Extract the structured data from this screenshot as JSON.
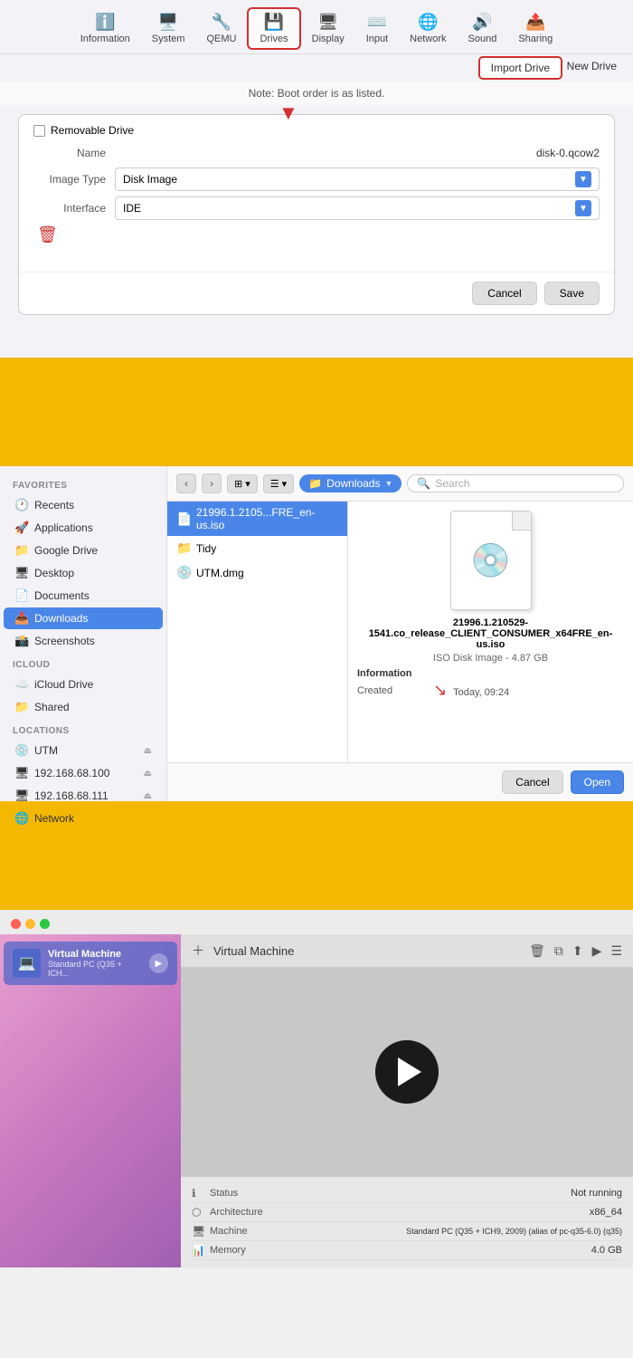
{
  "section1": {
    "toolbar": {
      "items": [
        {
          "id": "information",
          "label": "Information",
          "icon": "ℹ️"
        },
        {
          "id": "system",
          "label": "System",
          "icon": "🖥️"
        },
        {
          "id": "qemu",
          "label": "QEMU",
          "icon": "🔧"
        },
        {
          "id": "drives",
          "label": "Drives",
          "icon": "💾"
        },
        {
          "id": "display",
          "label": "Display",
          "icon": "🖥"
        },
        {
          "id": "input",
          "label": "Input",
          "icon": "⌨️"
        },
        {
          "id": "network",
          "label": "Network",
          "icon": "🌐"
        },
        {
          "id": "sound",
          "label": "Sound",
          "icon": "🔊"
        },
        {
          "id": "sharing",
          "label": "Sharing",
          "icon": "📤"
        }
      ]
    },
    "note": "Note: Boot order is as listed.",
    "import_btn": "Import Drive",
    "new_btn": "New Drive",
    "removable_label": "Removable Drive",
    "name_label": "Name",
    "name_value": "disk-0.qcow2",
    "image_type_label": "Image Type",
    "image_type_value": "Disk Image",
    "interface_label": "Interface",
    "interface_value": "IDE",
    "cancel_btn": "Cancel",
    "save_btn": "Save"
  },
  "section2": {
    "sidebar": {
      "sections": [
        {
          "label": "Favorites",
          "items": [
            {
              "id": "recents",
              "label": "Recents",
              "icon": "🕐"
            },
            {
              "id": "applications",
              "label": "Applications",
              "icon": "🚀"
            },
            {
              "id": "google-drive",
              "label": "Google Drive",
              "icon": "📁"
            },
            {
              "id": "desktop",
              "label": "Desktop",
              "icon": "🖥"
            },
            {
              "id": "documents",
              "label": "Documents",
              "icon": "📄"
            },
            {
              "id": "downloads",
              "label": "Downloads",
              "icon": "📥"
            },
            {
              "id": "screenshots",
              "label": "Screenshots",
              "icon": "📸"
            }
          ]
        },
        {
          "label": "iCloud",
          "items": [
            {
              "id": "icloud-drive",
              "label": "iCloud Drive",
              "icon": "☁️"
            },
            {
              "id": "shared",
              "label": "Shared",
              "icon": "📁"
            }
          ]
        },
        {
          "label": "Locations",
          "items": [
            {
              "id": "utm",
              "label": "UTM",
              "icon": "💿"
            },
            {
              "id": "ip1",
              "label": "192.168.68.100",
              "icon": "🖥"
            },
            {
              "id": "ip2",
              "label": "192.168.68.111",
              "icon": "🖥"
            },
            {
              "id": "network",
              "label": "Network",
              "icon": "🌐"
            }
          ]
        }
      ]
    },
    "location": "Downloads",
    "search_placeholder": "Search",
    "files": [
      {
        "name": "21996.1.2105...FRE_en-us.iso",
        "icon": "📄",
        "selected": true
      },
      {
        "name": "Tidy",
        "icon": "📁",
        "selected": false
      },
      {
        "name": "UTM.dmg",
        "icon": "💿",
        "selected": false
      }
    ],
    "preview": {
      "filename": "21996.1.210529-1541.co_release_CLIENT_CONSUMER_x64FRE_en-us.iso",
      "type": "ISO Disk Image - 4.87 GB",
      "info_label": "Information",
      "created_label": "Created",
      "created_value": "Today, 09:24"
    },
    "cancel_btn": "Cancel",
    "open_btn": "Open"
  },
  "section3": {
    "vm_name": "Virtual Machine",
    "vm_label": "Virtual Machine",
    "vm_desc": "Standard PC (Q35 + ICH...",
    "header_title": "Virtual Machine",
    "info_rows": [
      {
        "icon": "ℹ",
        "label": "Status",
        "value": "Not running"
      },
      {
        "icon": "⬡",
        "label": "Architecture",
        "value": "x86_64"
      },
      {
        "icon": "🖥",
        "label": "Machine",
        "value": "Standard PC (Q35 + ICH9, 2009) (alias of pc-q35-6.0) (q35)"
      },
      {
        "icon": "📊",
        "label": "Memory",
        "value": "4.0 GB"
      }
    ]
  }
}
